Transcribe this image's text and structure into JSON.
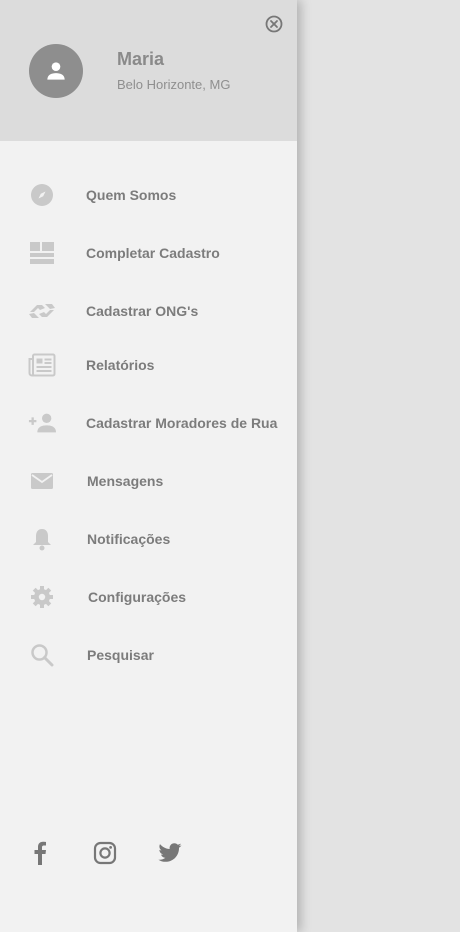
{
  "user": {
    "name": "Maria",
    "location": "Belo Horizonte, MG"
  },
  "menu": {
    "items": [
      {
        "label": "Quem Somos",
        "icon": "compass-icon"
      },
      {
        "label": "Completar Cadastro",
        "icon": "dashboard-layout-icon"
      },
      {
        "label": "Cadastrar ONG's",
        "icon": "handshake-icon"
      },
      {
        "label": "Relatórios",
        "icon": "newspaper-icon"
      },
      {
        "label": "Cadastrar Moradores de Rua",
        "icon": "person-add-icon"
      },
      {
        "label": "Mensagens",
        "icon": "mail-icon"
      },
      {
        "label": "Notificações",
        "icon": "bell-icon"
      },
      {
        "label": "Configurações",
        "icon": "gear-icon"
      },
      {
        "label": "Pesquisar",
        "icon": "search-icon"
      }
    ]
  },
  "social": [
    "facebook-icon",
    "instagram-icon",
    "twitter-icon"
  ],
  "colors": {
    "drawer_bg": "#f2f2f2",
    "header_bg": "#dcdcdc",
    "icon": "#c9c9c9",
    "label": "#7c7c7c",
    "backdrop": "#e3e3e3"
  }
}
